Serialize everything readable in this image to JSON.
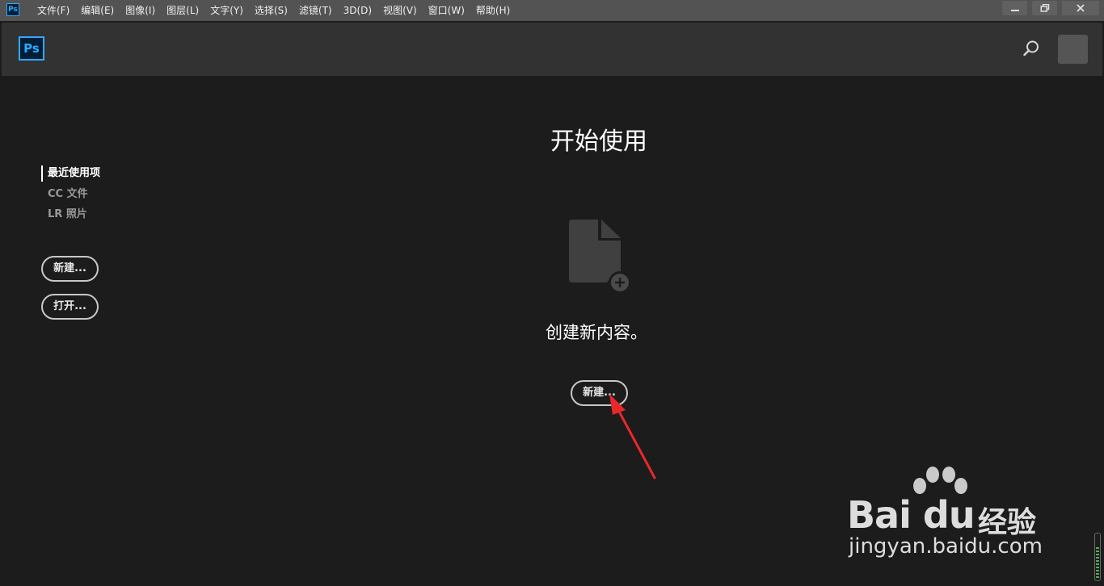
{
  "menubar": {
    "app_icon": "Ps",
    "items": [
      "文件(F)",
      "编辑(E)",
      "图像(I)",
      "图层(L)",
      "文字(Y)",
      "选择(S)",
      "滤镜(T)",
      "3D(D)",
      "视图(V)",
      "窗口(W)",
      "帮助(H)"
    ],
    "window_controls": [
      "minimize-icon",
      "restore-icon",
      "close-icon"
    ]
  },
  "header": {
    "logo": "Ps",
    "search_icon": "search-icon",
    "avatar": "avatar"
  },
  "sidebar": {
    "nav": [
      {
        "label": "最近使用项",
        "active": true
      },
      {
        "label": "CC 文件",
        "active": false
      },
      {
        "label": "LR 照片",
        "active": false
      }
    ],
    "new_button": "新建...",
    "open_button": "打开..."
  },
  "main": {
    "title": "开始使用",
    "icon": "new-document-icon",
    "create_text": "创建新内容。",
    "new_button": "新建..."
  },
  "watermark": {
    "brand": "Bai  du",
    "chinese": "经验",
    "url": "jingyan.baidu.com"
  },
  "colors": {
    "menubar_bg": "#535353",
    "header_bg": "#323232",
    "body_bg": "#1c1c1c",
    "ps_blue": "#31a8ff",
    "arrow_red": "#e8282a"
  }
}
